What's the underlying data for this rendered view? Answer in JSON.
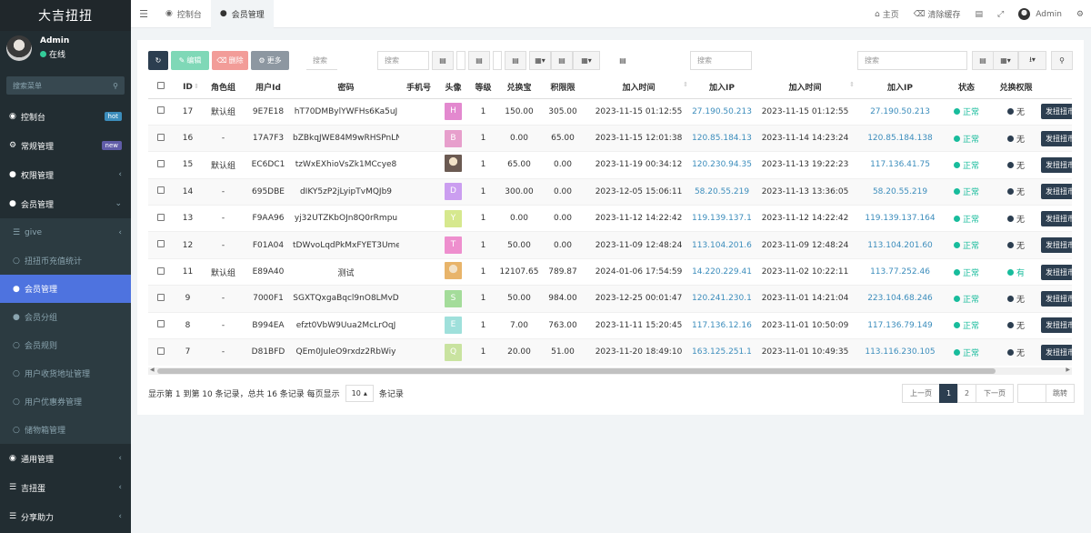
{
  "brand": "大吉扭扭",
  "user": {
    "name": "Admin",
    "status": "在线"
  },
  "sidebar": {
    "search_placeholder": "搜索菜单",
    "items": [
      {
        "label": "控制台",
        "badge": "hot"
      },
      {
        "label": "常规管理",
        "badge": "new"
      },
      {
        "label": "权限管理"
      },
      {
        "label": "会员管理"
      },
      {
        "label": "give"
      },
      {
        "label": "扭扭币充值统计"
      },
      {
        "label": "会员管理"
      },
      {
        "label": "会员分组"
      },
      {
        "label": "会员规则"
      },
      {
        "label": "用户收货地址管理"
      },
      {
        "label": "用户优惠券管理"
      },
      {
        "label": "储物箱管理"
      },
      {
        "label": "通用管理"
      },
      {
        "label": "吉扭蛋"
      },
      {
        "label": "分享助力"
      }
    ]
  },
  "topnav": {
    "tabs": [
      "控制台",
      "会员管理"
    ],
    "home": "主页",
    "clear_cache": "清除缓存",
    "admin": "Admin"
  },
  "toolbar": {
    "edit": "编辑",
    "delete": "删除",
    "more": "更多",
    "search_placeholder": "搜索"
  },
  "table": {
    "headers": [
      "ID",
      "角色组",
      "用户Id",
      "密码",
      "手机号",
      "头像",
      "等级",
      "兑换宝",
      "积限限",
      "加入时间",
      "加入IP",
      "加入时间",
      "加入IP",
      "状态",
      "兑换权限"
    ],
    "rows": [
      {
        "id": "17",
        "role": "默认组",
        "uid": "9E7E18",
        "pwd": "hT70DMBylYWFHs6Ka5uJ",
        "avatar": "H",
        "avatar_color": "#e389cf",
        "level": "1",
        "coin": "150.00",
        "limit": "305.00",
        "t1": "2023-11-15 01:12:55",
        "ip1": "27.190.50.213",
        "t2": "2023-11-15 01:12:55",
        "ip2": "27.190.50.213",
        "status": "正常",
        "perm": "无",
        "action": "发扭扭币"
      },
      {
        "id": "16",
        "role": "-",
        "uid": "17A7F3",
        "pwd": "bZBkqJWE84M9wRHSPnLN",
        "avatar": "B",
        "avatar_color": "#e79fcc",
        "level": "1",
        "coin": "0.00",
        "limit": "65.00",
        "t1": "2023-11-15 12:01:38",
        "ip1": "120.85.184.138",
        "t2": "2023-11-14 14:23:24",
        "ip2": "120.85.184.138",
        "status": "正常",
        "perm": "无",
        "action": "发扭扭币"
      },
      {
        "id": "15",
        "role": "默认组",
        "uid": "EC6DC1",
        "pwd": "tzWxEXhioVsZk1MCcye8",
        "avatar": "",
        "avatar_color": "#6b5a52",
        "level": "1",
        "coin": "65.00",
        "limit": "0.00",
        "t1": "2023-11-19 00:34:12",
        "ip1": "120.230.94.35",
        "t2": "2023-11-13 19:22:23",
        "ip2": "117.136.41.75",
        "status": "正常",
        "perm": "无",
        "action": "发扭扭币"
      },
      {
        "id": "14",
        "role": "-",
        "uid": "695DBE",
        "pwd": "dIKY5zP2jLyipTvMQJb9",
        "avatar": "D",
        "avatar_color": "#cb9ef0",
        "level": "1",
        "coin": "300.00",
        "limit": "0.00",
        "t1": "2023-12-05 15:06:11",
        "ip1": "58.20.55.219",
        "t2": "2023-11-13 13:36:05",
        "ip2": "58.20.55.219",
        "status": "正常",
        "perm": "无",
        "action": "发扭扭币"
      },
      {
        "id": "13",
        "role": "-",
        "uid": "F9AA96",
        "pwd": "yj32UTZKbOJn8Q0rRmpu",
        "avatar": "Y",
        "avatar_color": "#d6e88e",
        "level": "1",
        "coin": "0.00",
        "limit": "0.00",
        "t1": "2023-11-12 14:22:42",
        "ip1": "119.139.137.164",
        "t2": "2023-11-12 14:22:42",
        "ip2": "119.139.137.164",
        "status": "正常",
        "perm": "无",
        "action": "发扭扭币"
      },
      {
        "id": "12",
        "role": "-",
        "uid": "F01A04",
        "pwd": "tDWvoLqdPkMxFYET3Ume",
        "avatar": "T",
        "avatar_color": "#ee8fce",
        "level": "1",
        "coin": "50.00",
        "limit": "0.00",
        "t1": "2023-11-09 12:48:24",
        "ip1": "113.104.201.60",
        "t2": "2023-11-09 12:48:24",
        "ip2": "113.104.201.60",
        "status": "正常",
        "perm": "无",
        "action": "发扭扭币"
      },
      {
        "id": "11",
        "role": "默认组",
        "uid": "E89A40",
        "pwd": "测试",
        "avatar": "",
        "avatar_color": "#e8b46a",
        "level": "1",
        "coin": "12107.65",
        "limit": "789.87",
        "t1": "2024-01-06 17:54:59",
        "ip1": "14.220.229.41",
        "t2": "2023-11-02 10:22:11",
        "ip2": "113.77.252.46",
        "status": "正常",
        "perm": "有",
        "action": "发扭扭币"
      },
      {
        "id": "9",
        "role": "-",
        "uid": "7000F1",
        "pwd": "SGXTQxgaBqcl9nO8LMvD",
        "avatar": "S",
        "avatar_color": "#a4dc9a",
        "level": "1",
        "coin": "50.00",
        "limit": "984.00",
        "t1": "2023-12-25 00:01:47",
        "ip1": "120.241.230.142",
        "t2": "2023-11-01 14:21:04",
        "ip2": "223.104.68.246",
        "status": "正常",
        "perm": "无",
        "action": "发扭扭币"
      },
      {
        "id": "8",
        "role": "-",
        "uid": "B994EA",
        "pwd": "efzt0VbW9Uua2McLrOqJ",
        "avatar": "E",
        "avatar_color": "#9fe0db",
        "level": "1",
        "coin": "7.00",
        "limit": "763.00",
        "t1": "2023-11-11 15:20:45",
        "ip1": "117.136.12.160",
        "t2": "2023-11-01 10:50:09",
        "ip2": "117.136.79.149",
        "status": "正常",
        "perm": "无",
        "action": "发扭扭币"
      },
      {
        "id": "7",
        "role": "-",
        "uid": "D81BFD",
        "pwd": "QEm0JuleO9rxdz2RbWiy",
        "avatar": "Q",
        "avatar_color": "#c9e3a0",
        "level": "1",
        "coin": "20.00",
        "limit": "51.00",
        "t1": "2023-11-20 18:49:10",
        "ip1": "163.125.251.178",
        "t2": "2023-11-01 10:49:35",
        "ip2": "113.116.230.105",
        "status": "正常",
        "perm": "无",
        "action": "发扭扭币"
      }
    ]
  },
  "footer": {
    "summary": "显示第 1 到第 10 条记录，总共 16 条记录 每页显示",
    "page_size": "10",
    "suffix": "条记录"
  },
  "pager": {
    "prev": "上一页",
    "pages": [
      "1",
      "2"
    ],
    "next": "下一页",
    "jump": "跳转"
  }
}
